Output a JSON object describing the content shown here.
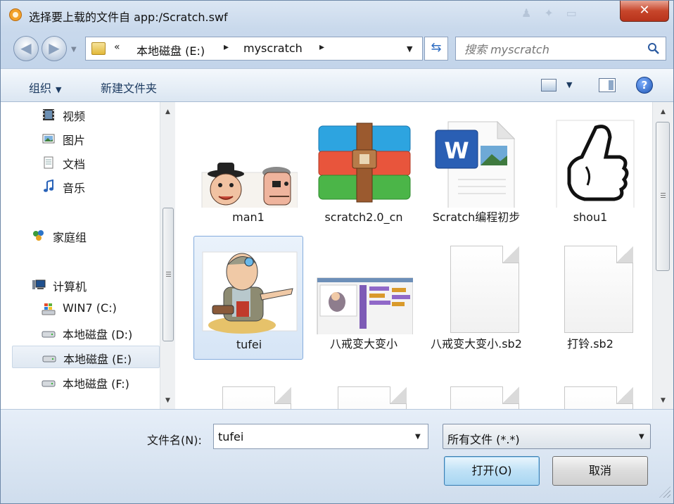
{
  "window": {
    "title": "选择要上载的文件自 app:/Scratch.swf",
    "close_label": "✕"
  },
  "address": {
    "overflow": "«",
    "parts": [
      "本地磁盘 (E:)",
      "myscratch"
    ],
    "separator": "▸",
    "search_placeholder": "搜索 myscratch"
  },
  "toolbar": {
    "organize": "组织",
    "new_folder": "新建文件夹",
    "help": "?"
  },
  "nav": {
    "items": [
      {
        "label": "视频",
        "icon": "video-icon"
      },
      {
        "label": "图片",
        "icon": "pictures-icon"
      },
      {
        "label": "文档",
        "icon": "documents-icon"
      },
      {
        "label": "音乐",
        "icon": "music-icon"
      },
      {
        "label": "家庭组",
        "icon": "homegroup-icon"
      },
      {
        "label": "计算机",
        "icon": "computer-icon"
      },
      {
        "label": "WIN7 (C:)",
        "icon": "windows-drive-icon"
      },
      {
        "label": "本地磁盘 (D:)",
        "icon": "drive-icon"
      },
      {
        "label": "本地磁盘 (E:)",
        "icon": "drive-icon",
        "selected": true
      },
      {
        "label": "本地磁盘 (F:)",
        "icon": "drive-icon"
      }
    ]
  },
  "files": [
    {
      "name": "man1",
      "kind": "image"
    },
    {
      "name": "scratch2.0_cn",
      "kind": "archive"
    },
    {
      "name": "Scratch编程初步",
      "kind": "word"
    },
    {
      "name": "shou1",
      "kind": "image"
    },
    {
      "name": "tufei",
      "kind": "image",
      "selected": true
    },
    {
      "name": "八戒变大变小",
      "kind": "screenshot"
    },
    {
      "name": "八戒变大变小.sb2",
      "kind": "blank"
    },
    {
      "name": "打铃.sb2",
      "kind": "blank"
    },
    {
      "name": "",
      "kind": "blank"
    },
    {
      "name": "",
      "kind": "blank"
    },
    {
      "name": "",
      "kind": "blank"
    },
    {
      "name": "",
      "kind": "blank"
    }
  ],
  "bottom": {
    "filename_label": "文件名(N):",
    "filename_value": "tufei",
    "filetype_value": "所有文件 (*.*)",
    "open_label": "打开(O)",
    "cancel_label": "取消"
  },
  "colors": {
    "accent": "#3c7fb1",
    "selection": "#d6e5f6",
    "close": "#c7462b"
  }
}
